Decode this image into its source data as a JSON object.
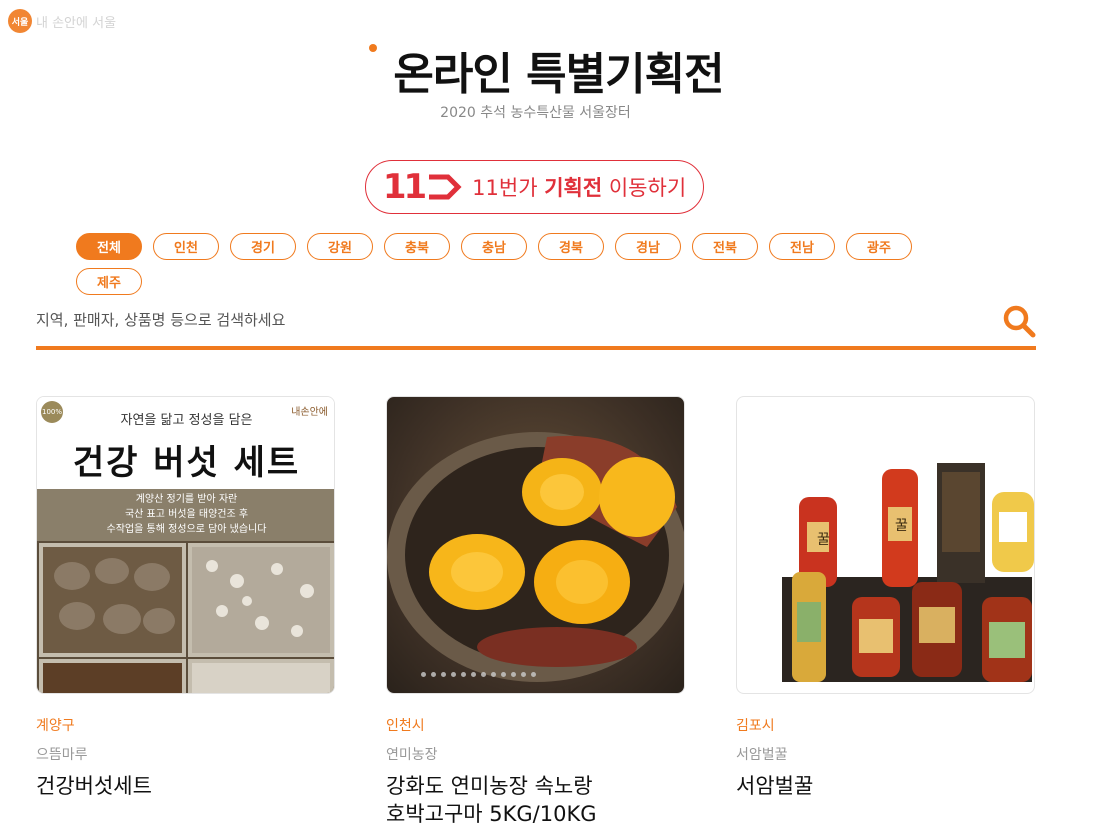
{
  "brand": {
    "label": "내 손안에 서울",
    "mark": "서울"
  },
  "header": {
    "title": "온라인 특별기획전",
    "subtitle": "2020 추석 농수특산물 서울장터"
  },
  "elevenst_button": {
    "logo": "11",
    "text_pre": "11번가 ",
    "text_bold": "기획전",
    "text_post": " 이동하기"
  },
  "regions": [
    "전체",
    "인천",
    "경기",
    "강원",
    "충북",
    "충남",
    "경북",
    "경남",
    "전북",
    "전남",
    "광주",
    "제주"
  ],
  "active_region": "전체",
  "search": {
    "placeholder": "지역, 판매자, 상품명 등으로 검색하세요",
    "value": ""
  },
  "colors": {
    "accent": "#f07a1e",
    "elevenst": "#e0303a"
  },
  "products": [
    {
      "region": "계양구",
      "seller": "으뜸마루",
      "name": "건강버섯세트",
      "image_text": {
        "subtitle": "자연을 닮고 정성을 담은",
        "title": "건강 버섯 세트",
        "band": [
          "계양산 정기를 받아 자란",
          "국산 표고 버섯을 태양건조 후",
          "수작업을 통해 정성으로 담아 냈습니다"
        ],
        "seal": "100%",
        "corner": "내손안에"
      }
    },
    {
      "region": "인천시",
      "seller": "연미농장",
      "name_line1": "강화도 연미농장 속노랑",
      "name_line2": "호박고구마 5KG/10KG"
    },
    {
      "region": "김포시",
      "seller": "서암벌꿀",
      "name": "서암벌꿀",
      "jar_label": "꿀"
    }
  ]
}
